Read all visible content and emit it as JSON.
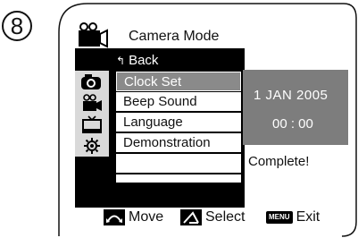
{
  "step": {
    "number": "8"
  },
  "header": {
    "title": "Camera Mode",
    "icon": "camera-mode-icon"
  },
  "sidebar": {
    "items": [
      {
        "icon": "camera-icon"
      },
      {
        "icon": "camcorder-icon"
      },
      {
        "icon": "tv-icon"
      },
      {
        "icon": "settings-gear-icon"
      }
    ]
  },
  "menu": {
    "back_label": "Back",
    "back_arrow": "↰",
    "items": [
      {
        "label": "Clock Set",
        "selected": true
      },
      {
        "label": "Beep Sound",
        "selected": false
      },
      {
        "label": "Language",
        "selected": false
      },
      {
        "label": "Demonstration",
        "selected": false
      }
    ]
  },
  "value_panel": {
    "date": "1  JAN  2005",
    "time": "00 : 00"
  },
  "status": {
    "text": "Complete!"
  },
  "footer": {
    "move_label": "Move",
    "select_label": "Select",
    "menu_key": "MENU",
    "exit_label": "Exit"
  },
  "colors": {
    "osd_background": "#000000",
    "selected_item": "#8a8a8a",
    "value_panel": "#7d7d7d",
    "side_column": "#d9d9d9"
  }
}
